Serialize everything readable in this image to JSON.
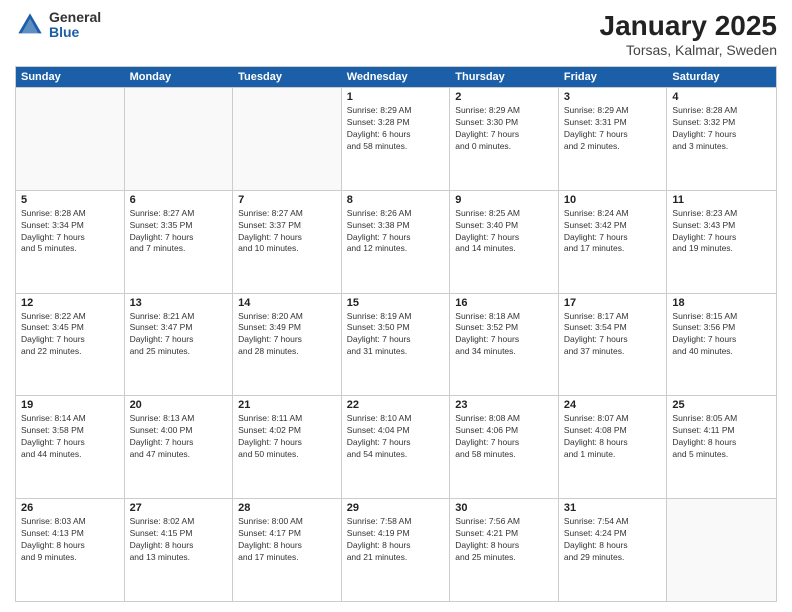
{
  "header": {
    "logo_general": "General",
    "logo_blue": "Blue",
    "title": "January 2025",
    "subtitle": "Torsas, Kalmar, Sweden"
  },
  "weekdays": [
    "Sunday",
    "Monday",
    "Tuesday",
    "Wednesday",
    "Thursday",
    "Friday",
    "Saturday"
  ],
  "rows": [
    [
      {
        "day": "",
        "info": "",
        "empty": true
      },
      {
        "day": "",
        "info": "",
        "empty": true
      },
      {
        "day": "",
        "info": "",
        "empty": true
      },
      {
        "day": "1",
        "info": "Sunrise: 8:29 AM\nSunset: 3:28 PM\nDaylight: 6 hours\nand 58 minutes."
      },
      {
        "day": "2",
        "info": "Sunrise: 8:29 AM\nSunset: 3:30 PM\nDaylight: 7 hours\nand 0 minutes."
      },
      {
        "day": "3",
        "info": "Sunrise: 8:29 AM\nSunset: 3:31 PM\nDaylight: 7 hours\nand 2 minutes."
      },
      {
        "day": "4",
        "info": "Sunrise: 8:28 AM\nSunset: 3:32 PM\nDaylight: 7 hours\nand 3 minutes."
      }
    ],
    [
      {
        "day": "5",
        "info": "Sunrise: 8:28 AM\nSunset: 3:34 PM\nDaylight: 7 hours\nand 5 minutes."
      },
      {
        "day": "6",
        "info": "Sunrise: 8:27 AM\nSunset: 3:35 PM\nDaylight: 7 hours\nand 7 minutes."
      },
      {
        "day": "7",
        "info": "Sunrise: 8:27 AM\nSunset: 3:37 PM\nDaylight: 7 hours\nand 10 minutes."
      },
      {
        "day": "8",
        "info": "Sunrise: 8:26 AM\nSunset: 3:38 PM\nDaylight: 7 hours\nand 12 minutes."
      },
      {
        "day": "9",
        "info": "Sunrise: 8:25 AM\nSunset: 3:40 PM\nDaylight: 7 hours\nand 14 minutes."
      },
      {
        "day": "10",
        "info": "Sunrise: 8:24 AM\nSunset: 3:42 PM\nDaylight: 7 hours\nand 17 minutes."
      },
      {
        "day": "11",
        "info": "Sunrise: 8:23 AM\nSunset: 3:43 PM\nDaylight: 7 hours\nand 19 minutes."
      }
    ],
    [
      {
        "day": "12",
        "info": "Sunrise: 8:22 AM\nSunset: 3:45 PM\nDaylight: 7 hours\nand 22 minutes."
      },
      {
        "day": "13",
        "info": "Sunrise: 8:21 AM\nSunset: 3:47 PM\nDaylight: 7 hours\nand 25 minutes."
      },
      {
        "day": "14",
        "info": "Sunrise: 8:20 AM\nSunset: 3:49 PM\nDaylight: 7 hours\nand 28 minutes."
      },
      {
        "day": "15",
        "info": "Sunrise: 8:19 AM\nSunset: 3:50 PM\nDaylight: 7 hours\nand 31 minutes."
      },
      {
        "day": "16",
        "info": "Sunrise: 8:18 AM\nSunset: 3:52 PM\nDaylight: 7 hours\nand 34 minutes."
      },
      {
        "day": "17",
        "info": "Sunrise: 8:17 AM\nSunset: 3:54 PM\nDaylight: 7 hours\nand 37 minutes."
      },
      {
        "day": "18",
        "info": "Sunrise: 8:15 AM\nSunset: 3:56 PM\nDaylight: 7 hours\nand 40 minutes."
      }
    ],
    [
      {
        "day": "19",
        "info": "Sunrise: 8:14 AM\nSunset: 3:58 PM\nDaylight: 7 hours\nand 44 minutes."
      },
      {
        "day": "20",
        "info": "Sunrise: 8:13 AM\nSunset: 4:00 PM\nDaylight: 7 hours\nand 47 minutes."
      },
      {
        "day": "21",
        "info": "Sunrise: 8:11 AM\nSunset: 4:02 PM\nDaylight: 7 hours\nand 50 minutes."
      },
      {
        "day": "22",
        "info": "Sunrise: 8:10 AM\nSunset: 4:04 PM\nDaylight: 7 hours\nand 54 minutes."
      },
      {
        "day": "23",
        "info": "Sunrise: 8:08 AM\nSunset: 4:06 PM\nDaylight: 7 hours\nand 58 minutes."
      },
      {
        "day": "24",
        "info": "Sunrise: 8:07 AM\nSunset: 4:08 PM\nDaylight: 8 hours\nand 1 minute."
      },
      {
        "day": "25",
        "info": "Sunrise: 8:05 AM\nSunset: 4:11 PM\nDaylight: 8 hours\nand 5 minutes."
      }
    ],
    [
      {
        "day": "26",
        "info": "Sunrise: 8:03 AM\nSunset: 4:13 PM\nDaylight: 8 hours\nand 9 minutes."
      },
      {
        "day": "27",
        "info": "Sunrise: 8:02 AM\nSunset: 4:15 PM\nDaylight: 8 hours\nand 13 minutes."
      },
      {
        "day": "28",
        "info": "Sunrise: 8:00 AM\nSunset: 4:17 PM\nDaylight: 8 hours\nand 17 minutes."
      },
      {
        "day": "29",
        "info": "Sunrise: 7:58 AM\nSunset: 4:19 PM\nDaylight: 8 hours\nand 21 minutes."
      },
      {
        "day": "30",
        "info": "Sunrise: 7:56 AM\nSunset: 4:21 PM\nDaylight: 8 hours\nand 25 minutes."
      },
      {
        "day": "31",
        "info": "Sunrise: 7:54 AM\nSunset: 4:24 PM\nDaylight: 8 hours\nand 29 minutes."
      },
      {
        "day": "",
        "info": "",
        "empty": true
      }
    ]
  ]
}
